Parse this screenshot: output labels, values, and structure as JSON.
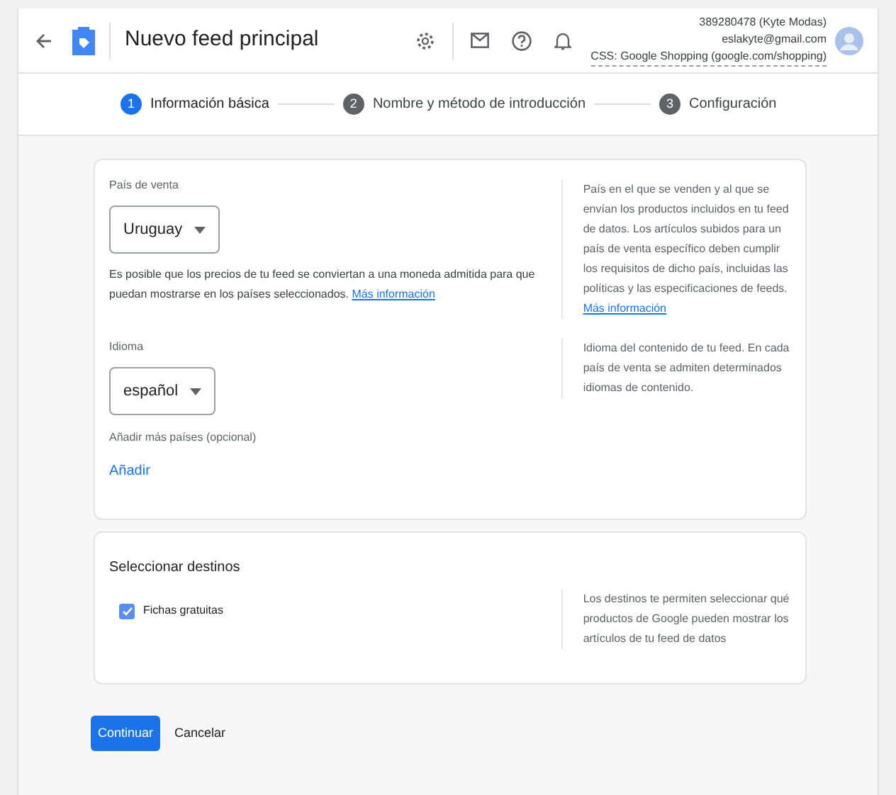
{
  "header": {
    "title": "Nuevo feed principal",
    "account_id": "389280478 (Kyte Modas)",
    "email": "eslakyte@gmail.com",
    "css": "CSS: Google Shopping (google.com/shopping)"
  },
  "steps": [
    {
      "number": "1",
      "label": "Información básica",
      "selected": true
    },
    {
      "number": "2",
      "label": "Nombre y método de introducción",
      "selected": false
    },
    {
      "number": "3",
      "label": "Configuración",
      "selected": false
    }
  ],
  "country_section": {
    "label": "País de venta",
    "value": "Uruguay",
    "note": "Es posible que los precios de tu feed se conviertan a una moneda admitida para que puedan mostrarse en los países seleccionados.",
    "note_link": "Más información",
    "help": "País en el que se venden y al que se envían los productos incluidos en tu feed de datos. Los artículos subidos para un país de venta específico deben cumplir los requisitos de dicho país, incluidas las políticas y las especificaciones de feeds.",
    "help_link": "Más información"
  },
  "language_section": {
    "label": "Idioma",
    "value": "español",
    "help": "Idioma del contenido de tu feed. En cada país de venta se admiten determinados idiomas de contenido.",
    "more_label": "Añadir más países (opcional)",
    "add_link": "Añadir"
  },
  "destinations": {
    "title": "Seleccionar destinos",
    "items": [
      {
        "label": "Fichas gratuitas",
        "checked": true
      }
    ],
    "help": "Los destinos te permiten seleccionar qué productos de Google pueden mostrar los artículos de tu feed de datos"
  },
  "buttons": {
    "continue": "Continuar",
    "cancel": "Cancelar"
  }
}
